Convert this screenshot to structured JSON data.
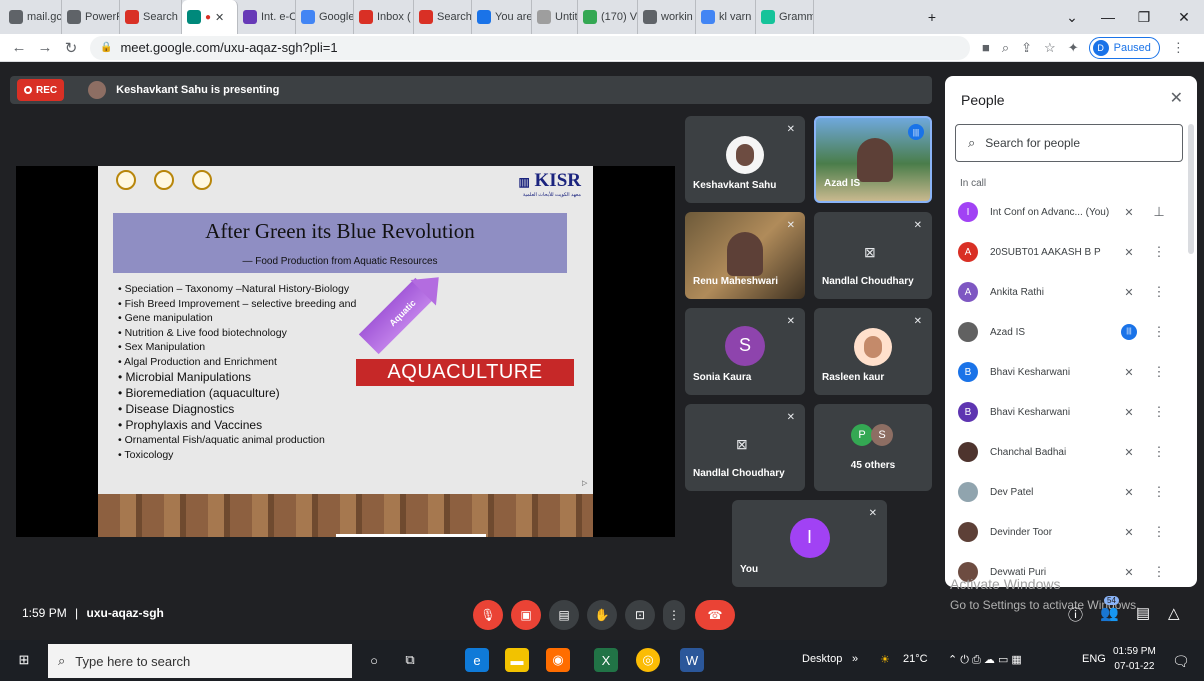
{
  "browser": {
    "tabs": [
      {
        "label": "mail.gc",
        "icon": "globe-icon",
        "color": "#5f6368"
      },
      {
        "label": "PowerP",
        "icon": "globe-icon",
        "color": "#5f6368"
      },
      {
        "label": "Search",
        "icon": "gmail-icon",
        "color": "#d93025"
      },
      {
        "label": "",
        "icon": "meet-icon",
        "color": "#00897b"
      },
      {
        "label": "Int. e-C",
        "icon": "forms-icon",
        "color": "#673ab7"
      },
      {
        "label": "Google",
        "icon": "google-icon",
        "color": "#4285f4"
      },
      {
        "label": "Inbox (",
        "icon": "gmail-icon",
        "color": "#d93025"
      },
      {
        "label": "Search",
        "icon": "gmail-icon",
        "color": "#d93025"
      },
      {
        "label": "You are",
        "icon": "s-icon",
        "color": "#1a73e8"
      },
      {
        "label": "Untitle",
        "icon": "globe-icon",
        "color": "#9e9e9e"
      },
      {
        "label": "(170) V",
        "icon": "chrome-app-icon",
        "color": "#34a853"
      },
      {
        "label": "workin",
        "icon": "globe-icon",
        "color": "#5f6368"
      },
      {
        "label": "kl varn",
        "icon": "google-icon",
        "color": "#4285f4"
      },
      {
        "label": "Gramm",
        "icon": "grammarly-icon",
        "color": "#15c39a"
      }
    ],
    "url": "meet.google.com/uxu-aqaz-sgh?pli=1",
    "profile_initial": "D",
    "profile_status": "Paused"
  },
  "meet": {
    "rec_label": "REC",
    "presenting_text": "Keshavkant Sahu is presenting",
    "time": "1:59 PM",
    "separator": "|",
    "meeting_code": "uxu-aqaz-sgh"
  },
  "slide": {
    "org": "KISR",
    "org_sub": "معهد الكويت للأبحاث العلمية",
    "title": "After Green its Blue Revolution",
    "subtitle": "— Food Production from Aquatic Resources",
    "bullets": [
      {
        "text": "Speciation – Taxonomy –Natural History-Biology",
        "big": false
      },
      {
        "text": "Fish Breed Improvement – selective breeding and",
        "big": false
      },
      {
        "text": "Gene manipulation",
        "big": false
      },
      {
        "text": "Nutrition & Live food biotechnology",
        "big": false
      },
      {
        "text": "Sex Manipulation",
        "big": false
      },
      {
        "text": "Algal Production and Enrichment",
        "big": false
      },
      {
        "text": "Microbial Manipulations",
        "big": true
      },
      {
        "text": "Bioremediation (aquaculture)",
        "big": true
      },
      {
        "text": "Disease Diagnostics",
        "big": true
      },
      {
        "text": "Prophylaxis and Vaccines",
        "big": true
      },
      {
        "text": "Ornamental Fish/aquatic animal production",
        "big": false
      },
      {
        "text": "Toxicology",
        "big": false
      }
    ],
    "arrow_label": "Aquatic",
    "banner": "AQUACULTURE"
  },
  "tiles": [
    {
      "name": "Keshavkant Sahu",
      "kind": "photo"
    },
    {
      "name": "Azad IS",
      "kind": "video"
    },
    {
      "name": "Renu Maheshwari",
      "kind": "video"
    },
    {
      "name": "Nandlal Choudhary",
      "kind": "camoff"
    },
    {
      "name": "Sonia Kaura",
      "kind": "avatar",
      "initial": "S",
      "color": "#8e44ad"
    },
    {
      "name": "Rasleen kaur",
      "kind": "photo"
    },
    {
      "name": "Nandlal Choudhary",
      "kind": "camoff"
    },
    {
      "name": "45 others",
      "kind": "others",
      "initials": [
        "P",
        "S"
      ],
      "colors": [
        "#34a853",
        "#8d6e63"
      ]
    },
    {
      "name": "You",
      "kind": "avatar",
      "initial": "I",
      "color": "#a142f4"
    }
  ],
  "people_panel": {
    "title": "People",
    "search_placeholder": "Search for people",
    "section": "In call",
    "participants": [
      {
        "name": "Int Conf on Advanc...",
        "suffix": "(You)",
        "initial": "I",
        "color": "#a142f4",
        "speaking": false,
        "pin": true
      },
      {
        "name": "20SUBT01 AAKASH B P",
        "suffix": "",
        "initial": "A",
        "color": "#d93025",
        "speaking": false,
        "pin": false
      },
      {
        "name": "Ankita Rathi",
        "suffix": "",
        "initial": "A",
        "color": "#7e57c2",
        "speaking": false,
        "pin": false
      },
      {
        "name": "Azad IS",
        "suffix": "",
        "initial": "",
        "color": "#616161",
        "speaking": true,
        "pin": false
      },
      {
        "name": "Bhavi Kesharwani",
        "suffix": "",
        "initial": "B",
        "color": "#1a73e8",
        "speaking": false,
        "pin": false
      },
      {
        "name": "Bhavi Kesharwani",
        "suffix": "",
        "initial": "B",
        "color": "#5e35b1",
        "speaking": false,
        "pin": false
      },
      {
        "name": "Chanchal Badhai",
        "suffix": "",
        "initial": "",
        "color": "#4e342e",
        "speaking": false,
        "pin": false
      },
      {
        "name": "Dev Patel",
        "suffix": "",
        "initial": "",
        "color": "#90a4ae",
        "speaking": false,
        "pin": false
      },
      {
        "name": "Devinder Toor",
        "suffix": "",
        "initial": "",
        "color": "#5d4037",
        "speaking": false,
        "pin": false
      },
      {
        "name": "Devwati Puri",
        "suffix": "",
        "initial": "",
        "color": "#6d4c41",
        "speaking": false,
        "pin": false
      }
    ]
  },
  "participant_badge": "54",
  "watermark": {
    "line1": "Activate Windows",
    "line2": "Go to Settings to activate Windows."
  },
  "taskbar": {
    "search_placeholder": "Type here to search",
    "desktop_label": "Desktop",
    "weather": "21°C",
    "language": "ENG",
    "time": "01:59 PM",
    "date": "07-01-22"
  },
  "colors": {
    "meet_bg": "#202124",
    "tile_bg": "#3c4043",
    "rec_red": "#d93025",
    "accent": "#1a73e8"
  }
}
